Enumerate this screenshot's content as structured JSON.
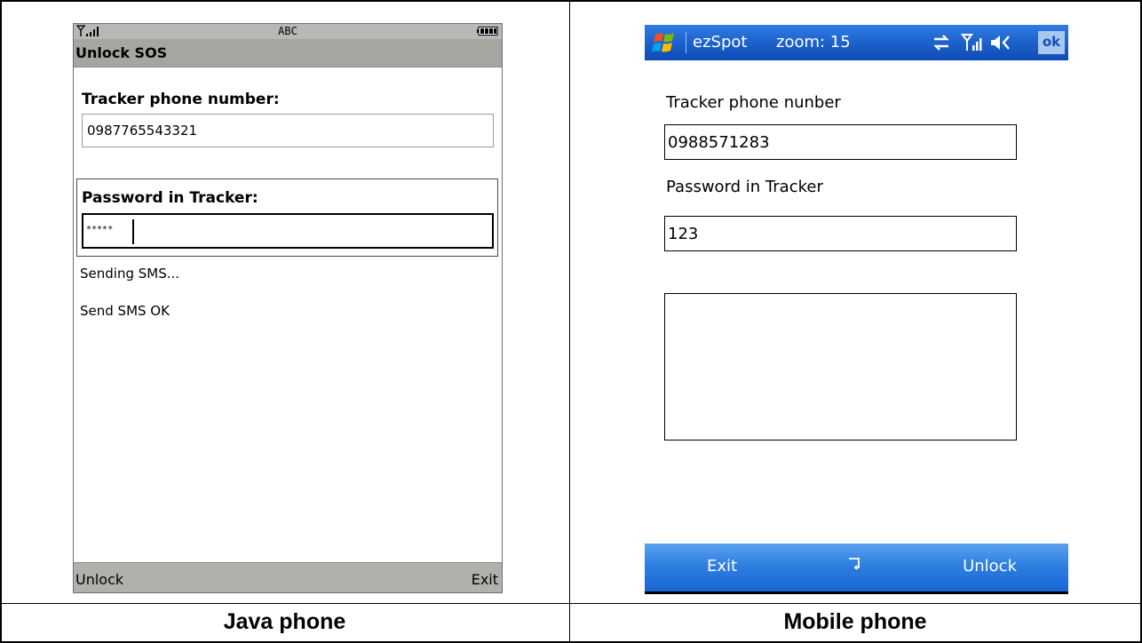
{
  "captions": {
    "left": "Java phone",
    "right": "Mobile phone"
  },
  "java_phone": {
    "status": {
      "signal_icon": "signal-strength-icon",
      "input_mode": "ABC",
      "battery_icon": "battery-icon"
    },
    "title": "Unlock SOS",
    "phone_label": "Tracker phone number:",
    "phone_value": "0987765543321",
    "password_label": "Password in Tracker:",
    "password_value": "*****",
    "messages": [
      "Sending SMS...",
      "Send SMS OK"
    ],
    "softkeys": {
      "left": "Unlock",
      "right": "Exit"
    }
  },
  "mobile_phone": {
    "titlebar": {
      "start_icon": "windows-start-icon",
      "app_name": "ezSpot",
      "zoom_text": "zoom: 15",
      "status_icons": [
        "connectivity-icon",
        "signal-strength-icon",
        "speaker-icon"
      ],
      "ok_label": "ok"
    },
    "phone_label": "Tracker phone nunber",
    "phone_value": "0988571283",
    "password_label": "Password in Tracker",
    "password_value": "123",
    "log_text": "",
    "menubar": {
      "left": "Exit",
      "middle_icon": "keyboard-icon",
      "right": "Unlock"
    }
  },
  "colors": {
    "java_bar": "#a6a6a1",
    "wm_blue": "#1b5fc9",
    "border": "#000000"
  }
}
